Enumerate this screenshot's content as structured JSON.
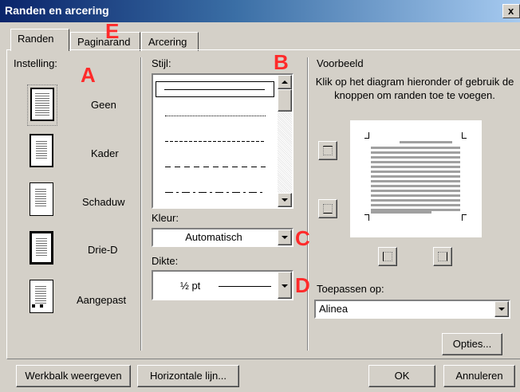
{
  "window": {
    "title": "Randen en arcering",
    "close_label": "x"
  },
  "tabs": [
    {
      "label": "Randen",
      "active": true
    },
    {
      "label": "Paginarand",
      "active": false
    },
    {
      "label": "Arcering",
      "active": false
    }
  ],
  "settings": {
    "heading": "Instelling:",
    "items": [
      {
        "label": "Geen",
        "icon": "setting-none-icon",
        "selected": true
      },
      {
        "label": "Kader",
        "icon": "setting-box-icon"
      },
      {
        "label": "Schaduw",
        "icon": "setting-shadow-icon"
      },
      {
        "label": "Drie-D",
        "icon": "setting-3d-icon"
      },
      {
        "label": "Aangepast",
        "icon": "setting-custom-icon"
      }
    ]
  },
  "style": {
    "heading": "Stijl:",
    "lines": [
      "solid",
      "dotted",
      "dashed-fine",
      "dashed",
      "dash-dot"
    ]
  },
  "color": {
    "heading": "Kleur:",
    "value": "Automatisch"
  },
  "width": {
    "heading": "Dikte:",
    "value": "½ pt"
  },
  "preview": {
    "heading": "Voorbeeld",
    "hint": "Klik op het diagram hieronder of gebruik de knoppen om randen toe te voegen."
  },
  "apply": {
    "heading": "Toepassen op:",
    "value": "Alinea"
  },
  "buttons": {
    "options": "Opties...",
    "toolbar": "Werkbalk weergeven",
    "horizontal": "Horizontale lijn...",
    "ok": "OK",
    "cancel": "Annuleren"
  },
  "annotations": {
    "a": "A",
    "b": "B",
    "c": "C",
    "d": "D",
    "e": "E"
  },
  "colors": {
    "annotation": "#ff2a2a",
    "face": "#d4d0c8",
    "title_start": "#0a246a"
  }
}
